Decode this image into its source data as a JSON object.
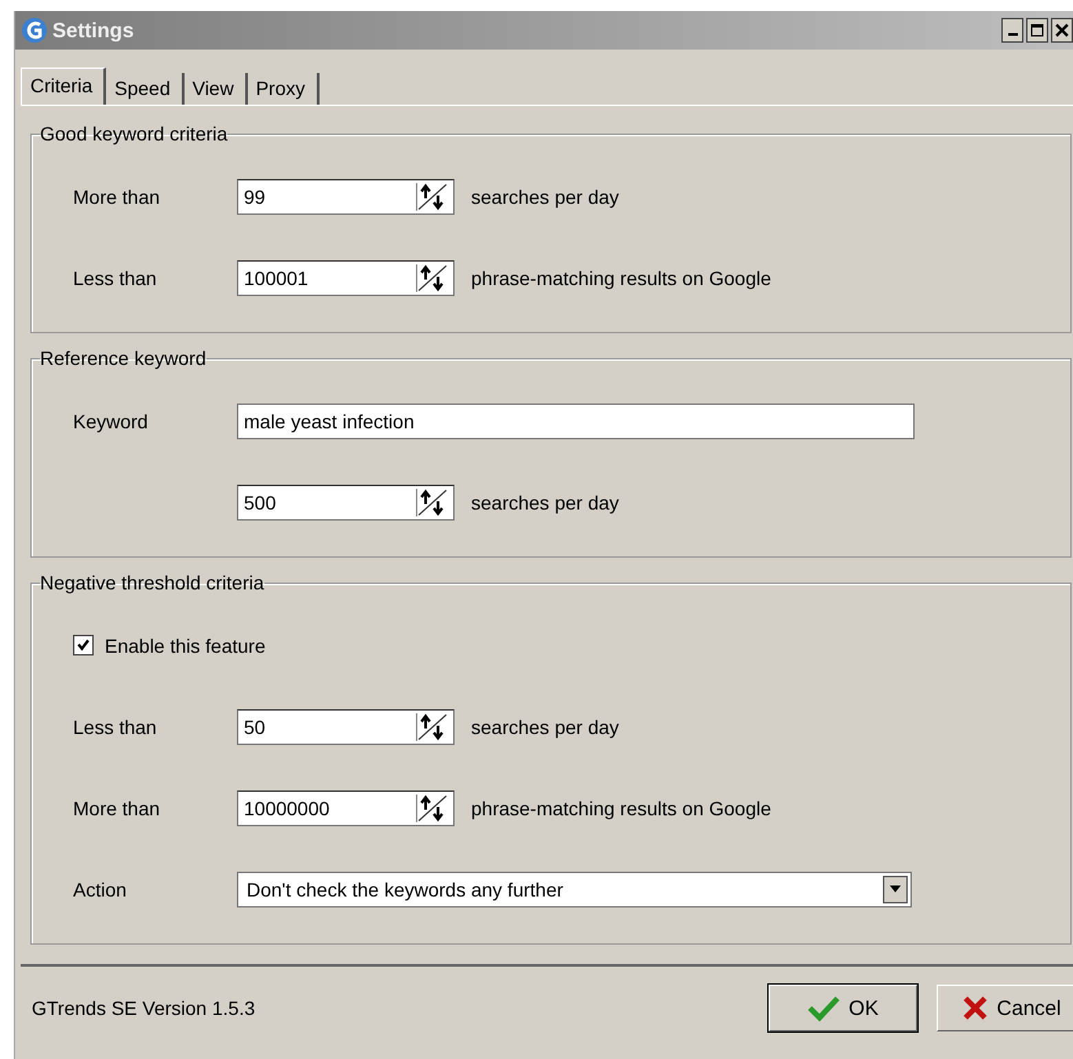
{
  "window": {
    "title": "Settings"
  },
  "tabs": [
    {
      "label": "Criteria",
      "selected": true
    },
    {
      "label": "Speed",
      "selected": false
    },
    {
      "label": "View",
      "selected": false
    },
    {
      "label": "Proxy",
      "selected": false
    }
  ],
  "groups": [
    {
      "title": "Good keyword criteria",
      "rows": [
        {
          "kind": "spin",
          "label": "More than",
          "value": "99",
          "suffix": "searches per day"
        },
        {
          "kind": "spin",
          "label": "Less than",
          "value": "100001",
          "suffix": "phrase-matching results on Google"
        }
      ]
    },
    {
      "title": "Reference keyword",
      "rows": [
        {
          "kind": "text",
          "label": "Keyword",
          "value": "male yeast infection"
        },
        {
          "kind": "spin",
          "value": "500",
          "suffix": "searches per day"
        }
      ]
    },
    {
      "title": "Negative threshold criteria",
      "rows": [
        {
          "kind": "checkbox",
          "label": "Enable this feature",
          "checked": true
        },
        {
          "kind": "spin",
          "label": "Less than",
          "value": "50",
          "suffix": "searches per day"
        },
        {
          "kind": "spin",
          "label": "More than",
          "value": "10000000",
          "suffix": "phrase-matching results on Google"
        },
        {
          "kind": "select",
          "label": "Action",
          "value": "Don't check the keywords any further"
        }
      ]
    }
  ],
  "footer": {
    "version": "GTrends SE Version 1.5.3",
    "buttons": [
      {
        "kind": "ok",
        "label": "OK"
      },
      {
        "kind": "cancel",
        "label": "Cancel"
      }
    ]
  }
}
